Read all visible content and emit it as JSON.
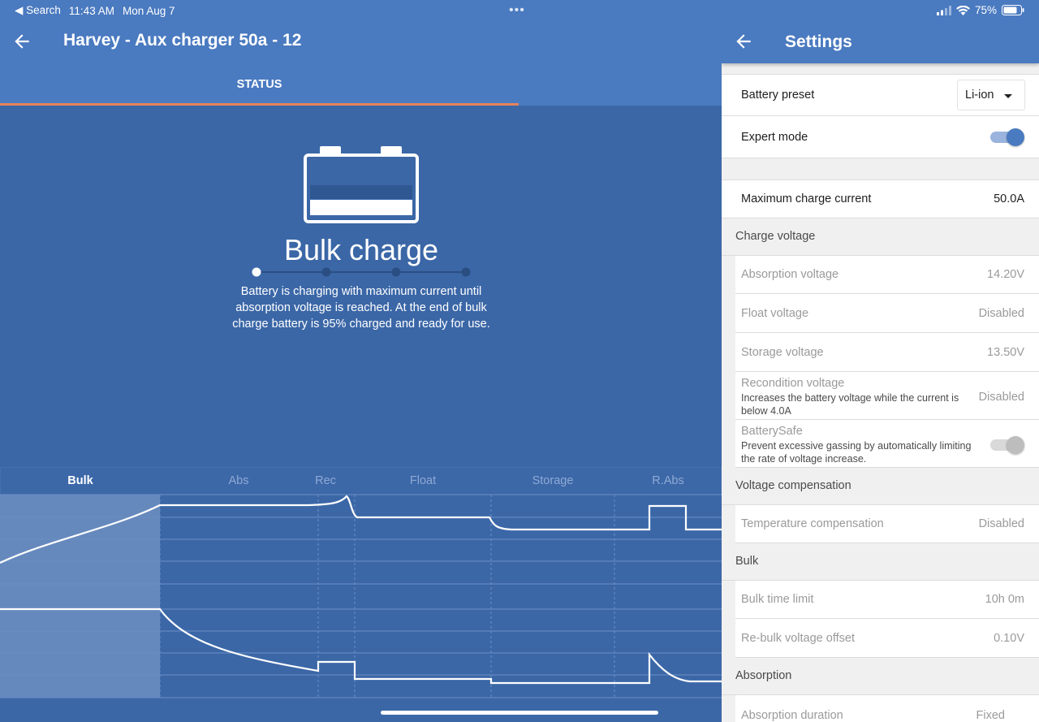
{
  "status_bar": {
    "back_app": "◀ Search",
    "time": "11:43 AM",
    "date": "Mon Aug 7",
    "battery_percent": "75%"
  },
  "left": {
    "title": "Harvey - Aux charger 50a - 12",
    "tab_label": "STATUS",
    "state_title": "Bulk charge",
    "state_desc": "Battery is charging with maximum current until absorption voltage is reached. At the end of bulk charge battery is 95% charged and ready for use.",
    "stepper_active_index": 0,
    "stepper_steps": 4,
    "phases": [
      "Bulk",
      "Abs",
      "Rec",
      "Float",
      "Storage",
      "R.Abs"
    ],
    "active_phase": "Bulk"
  },
  "right": {
    "title": "Settings",
    "battery_preset_label": "Battery preset",
    "battery_preset_value": "Li-ion",
    "expert_mode_label": "Expert mode",
    "expert_mode_on": true,
    "max_current_label": "Maximum charge current",
    "max_current_value": "50.0A",
    "charge_voltage_header": "Charge voltage",
    "absorption_voltage_label": "Absorption voltage",
    "absorption_voltage_value": "14.20V",
    "float_voltage_label": "Float voltage",
    "float_voltage_value": "Disabled",
    "storage_voltage_label": "Storage voltage",
    "storage_voltage_value": "13.50V",
    "recondition_voltage_label": "Recondition voltage",
    "recondition_voltage_desc": "Increases the battery voltage while the current is below 4.0A",
    "recondition_voltage_value": "Disabled",
    "batterysafe_label": "BatterySafe",
    "batterysafe_desc": "Prevent excessive gassing by automatically limiting the rate of voltage increase.",
    "batterysafe_on": true,
    "voltage_compensation_header": "Voltage compensation",
    "temperature_compensation_label": "Temperature compensation",
    "temperature_compensation_value": "Disabled",
    "bulk_header": "Bulk",
    "bulk_time_limit_label": "Bulk time limit",
    "bulk_time_limit_value": "10h 0m",
    "rebulk_offset_label": "Re-bulk voltage offset",
    "rebulk_offset_value": "0.10V",
    "absorption_header": "Absorption",
    "absorption_duration_label": "Absorption duration",
    "absorption_duration_value": "Fixed"
  },
  "colors": {
    "header_blue": "#4a7ac0",
    "body_blue": "#3b67a7",
    "tab_indicator": "#e7825a",
    "active_phase_band": "#6689bd"
  },
  "icons": [
    "back-arrow-icon",
    "battery-icon",
    "signal-icon",
    "wifi-icon",
    "battery-status-icon",
    "dropdown-caret-icon",
    "more-dots-icon"
  ]
}
